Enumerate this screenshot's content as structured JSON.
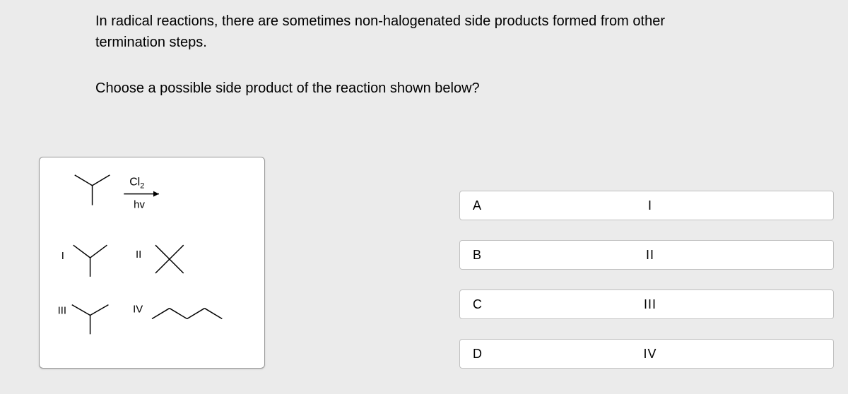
{
  "question": {
    "line1": "In radical reactions, there are sometimes non-halogenated side products formed from other termination steps.",
    "line2": "Choose a possible side product of the reaction shown below?"
  },
  "reaction": {
    "reagent_top": "Cl",
    "reagent_top_sub": "2",
    "reagent_bottom": "hv",
    "labels": {
      "r1": "I",
      "r2": "II",
      "r3": "III",
      "r4": "IV"
    }
  },
  "answers": [
    {
      "letter": "A",
      "value": "I"
    },
    {
      "letter": "B",
      "value": "II"
    },
    {
      "letter": "C",
      "value": "III"
    },
    {
      "letter": "D",
      "value": "IV"
    }
  ]
}
